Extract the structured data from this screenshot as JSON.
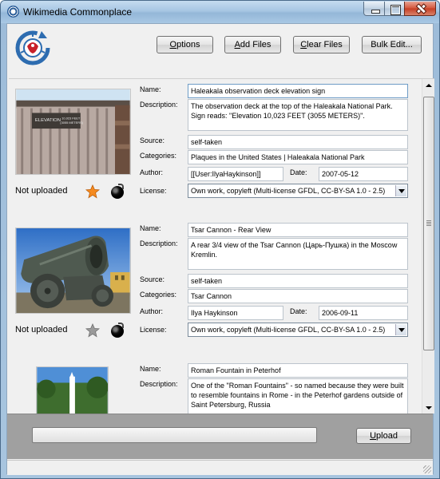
{
  "window": {
    "title": "Wikimedia Commonplace"
  },
  "toolbar": {
    "options_label": "Options",
    "options_mnemonic": "O",
    "options_rest": "ptions",
    "add_label": "Add Files",
    "add_mnemonic": "A",
    "add_rest": "dd Files",
    "clear_label": "Clear Files",
    "clear_mnemonic": "C",
    "clear_rest": "lear Files",
    "bulk_label": "Bulk Edit..."
  },
  "labels": {
    "name": "Name:",
    "description": "Description:",
    "source": "Source:",
    "categories": "Categories:",
    "author": "Author:",
    "date": "Date:",
    "license": "License:"
  },
  "files": [
    {
      "status": "Not uploaded",
      "starred": true,
      "name": "Haleakala observation deck elevation sign",
      "description": "The observation deck at the top of the Haleakala National Park. Sign reads: \"Elevation 10,023 FEET (3055 METERS)\".",
      "source": "self-taken",
      "categories": "Plaques in the United States | Haleakala National Park",
      "author": "[[User:IlyaHaykinson]]",
      "date": "2007-05-12",
      "license": "Own work, copyleft (Multi-license GFDL, CC-BY-SA 1.0 - 2.5)",
      "thumb_text_1": "ELEVATION",
      "thumb_text_2": "10,023 FEET",
      "thumb_text_3": "(3055 METERS)"
    },
    {
      "status": "Not uploaded",
      "starred": false,
      "name": "Tsar Cannon - Rear View",
      "description": "A rear 3/4 view of the Tsar Cannon (Царь-Пушка) in the Moscow Kremlin.",
      "source": "self-taken",
      "categories": "Tsar Cannon",
      "author": "Ilya Haykinson",
      "date": "2006-09-11",
      "license": "Own work, copyleft (Multi-license GFDL, CC-BY-SA 1.0 - 2.5)"
    },
    {
      "name": "Roman Fountain in Peterhof",
      "description": "One of the \"Roman Fountains\" - so named because they were built to resemble fountains in Rome - in the Peterhof gardens outside of Saint Petersburg, Russia"
    }
  ],
  "upload": {
    "label": "Upload",
    "mnemonic": "U",
    "rest": "pload",
    "progress": 0
  },
  "colors": {
    "starred": "#f58a1f",
    "unstarred": "#9a9a9a",
    "accent": "#2d5f9a"
  }
}
